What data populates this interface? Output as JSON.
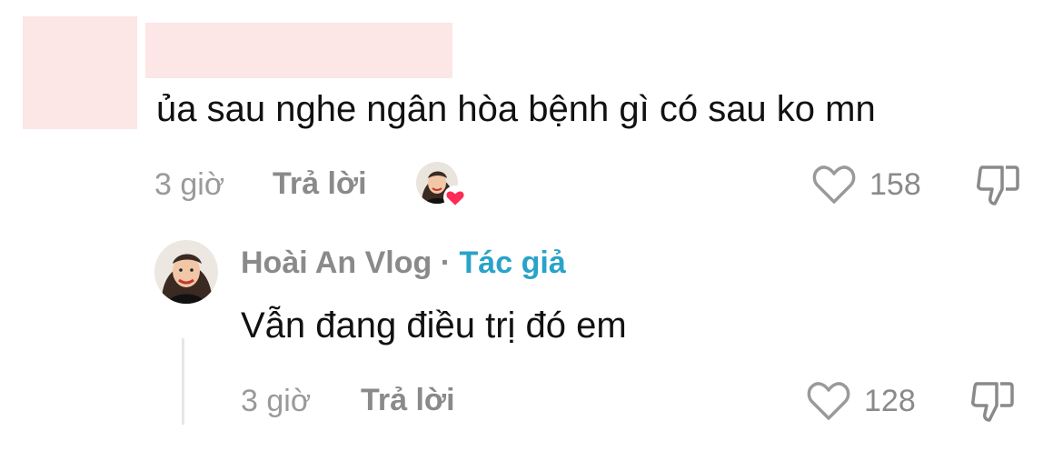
{
  "comment": {
    "text": "ủa sau nghe ngân hòa bệnh gì có sau ko mn",
    "time": "3 giờ",
    "reply_label": "Trả lời",
    "like_count": "158",
    "icons": [
      "heart-outline-icon",
      "thumbs-down-icon",
      "creator-liked-heart-icon"
    ]
  },
  "reply": {
    "author": "Hoài An Vlog",
    "separator": "·",
    "author_tag": "Tác giả",
    "text": "Vẫn đang điều trị đó em",
    "time": "3 giờ",
    "reply_label": "Trả lời",
    "like_count": "128"
  },
  "colors": {
    "redaction": "#fde6e6",
    "author_tag": "#2aa3c8",
    "meta_gray": "#8a8a8a",
    "heart_red": "#fe2c55"
  }
}
